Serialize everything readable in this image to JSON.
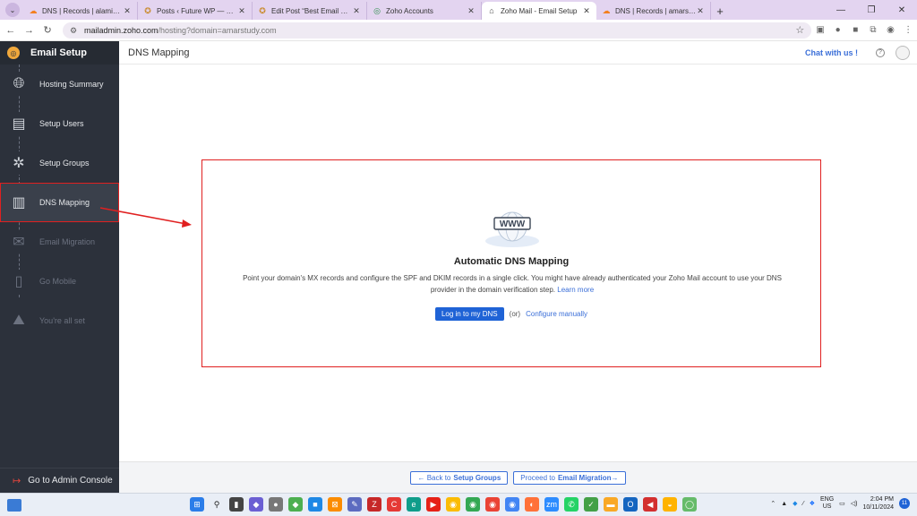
{
  "browser": {
    "tabs": [
      {
        "label": "DNS | Records | alaminislam.m...",
        "icon": "cloudflare-icon"
      },
      {
        "label": "Posts ‹ Future WP — WordPress",
        "icon": "wordpress-icon"
      },
      {
        "label": "Edit Post “Best Email Client For",
        "icon": "wordpress-icon"
      },
      {
        "label": "Zoho Accounts",
        "icon": "zoho-icon"
      },
      {
        "label": "Zoho Mail - Email Setup",
        "icon": "zoho-mail-icon",
        "active": true
      },
      {
        "label": "DNS | Records | amarstudy.com",
        "icon": "cloudflare-icon"
      }
    ],
    "url_host": "mailadmin.zoho.com",
    "url_path": "/hosting?domain=amarstudy.com"
  },
  "sidebar": {
    "title": "Email Setup",
    "steps": [
      {
        "label": "Hosting Summary",
        "icon": "globe-server-icon",
        "state": "done"
      },
      {
        "label": "Setup Users",
        "icon": "user-card-icon",
        "state": "done"
      },
      {
        "label": "Setup Groups",
        "icon": "group-icon",
        "state": "done"
      },
      {
        "label": "DNS Mapping",
        "icon": "dns-document-icon",
        "state": "active"
      },
      {
        "label": "Email Migration",
        "icon": "envelope-icon",
        "state": "disabled"
      },
      {
        "label": "Go Mobile",
        "icon": "mobile-icon",
        "state": "disabled"
      },
      {
        "label": "You're all set",
        "icon": "mountain-flag-icon",
        "state": "disabled"
      }
    ],
    "footer_label": "Go to Admin Console"
  },
  "header": {
    "page_title": "DNS Mapping",
    "chat_label": "Chat with us !"
  },
  "card": {
    "graphic_text": "WWW",
    "title": "Automatic DNS Mapping",
    "description": "Point your domain's MX records and configure the SPF and DKIM records in a single click. You might have already authenticated your Zoho Mail account to use your DNS provider in the domain verification step.",
    "learn_more": "Learn more",
    "primary_button": "Log in to my DNS",
    "or_text": "(or)",
    "secondary_link": "Configure manually"
  },
  "footer": {
    "back_prefix": "← Back to",
    "back_target": "Setup Groups",
    "next_prefix": "Proceed to",
    "next_target": "Email Migration→"
  },
  "taskbar": {
    "lang_top": "ENG",
    "lang_bottom": "US",
    "time": "2:04 PM",
    "date": "10/11/2024",
    "notification_count": "11"
  },
  "colors": {
    "sidebar_bg": "#2c313b",
    "accent_blue": "#1f63d6",
    "highlight_red": "#e02020"
  }
}
